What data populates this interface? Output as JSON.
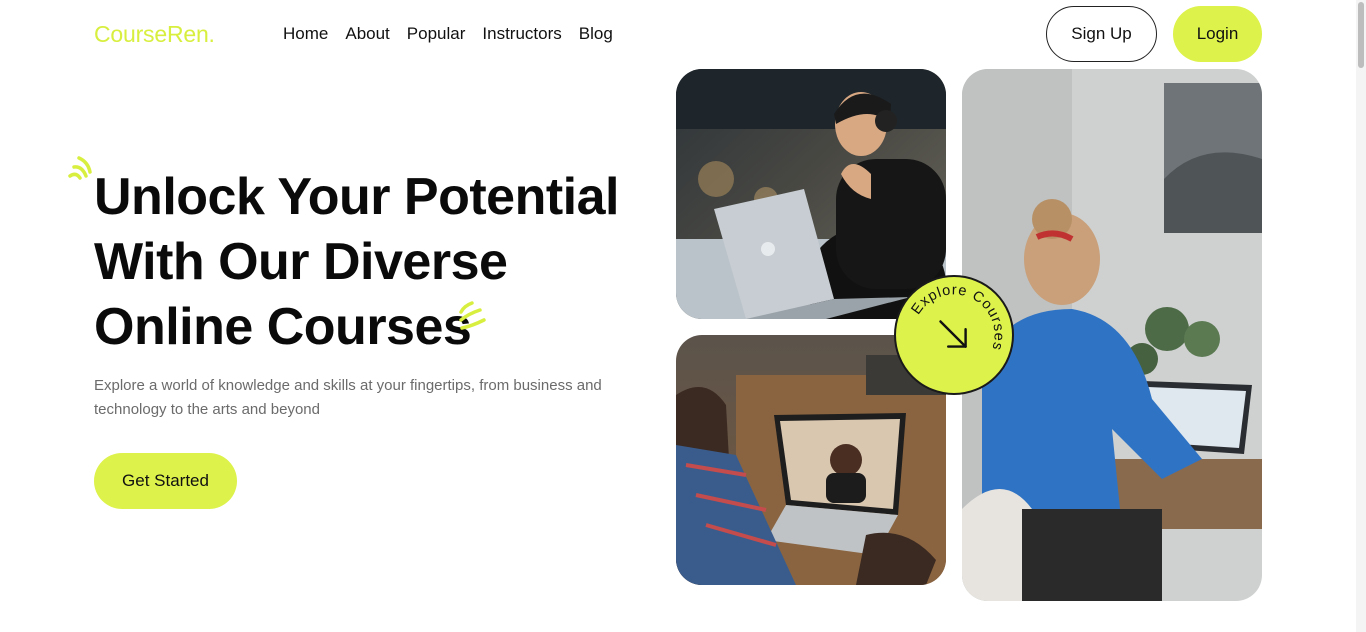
{
  "brand": {
    "logo": "CourseRen.",
    "accent_color": "#ddf24a"
  },
  "nav": {
    "items": [
      {
        "label": "Home"
      },
      {
        "label": "About"
      },
      {
        "label": "Popular"
      },
      {
        "label": "Instructors"
      },
      {
        "label": "Blog"
      }
    ],
    "signup_label": "Sign Up",
    "login_label": "Login"
  },
  "hero": {
    "title_lines": [
      "Unlock Your Potential",
      "With Our Diverse",
      "Online Courses"
    ],
    "subtitle": "Explore a world of knowledge and skills at your fingertips, from business and technology to the arts and beyond",
    "cta_label": "Get Started"
  },
  "badge": {
    "text": "Explore Courses",
    "icon": "arrow-down-right-icon"
  },
  "images": [
    {
      "name": "man-with-headphones-laptop-photo"
    },
    {
      "name": "video-call-laptop-photo"
    },
    {
      "name": "woman-blue-sweater-laptop-photo"
    }
  ]
}
